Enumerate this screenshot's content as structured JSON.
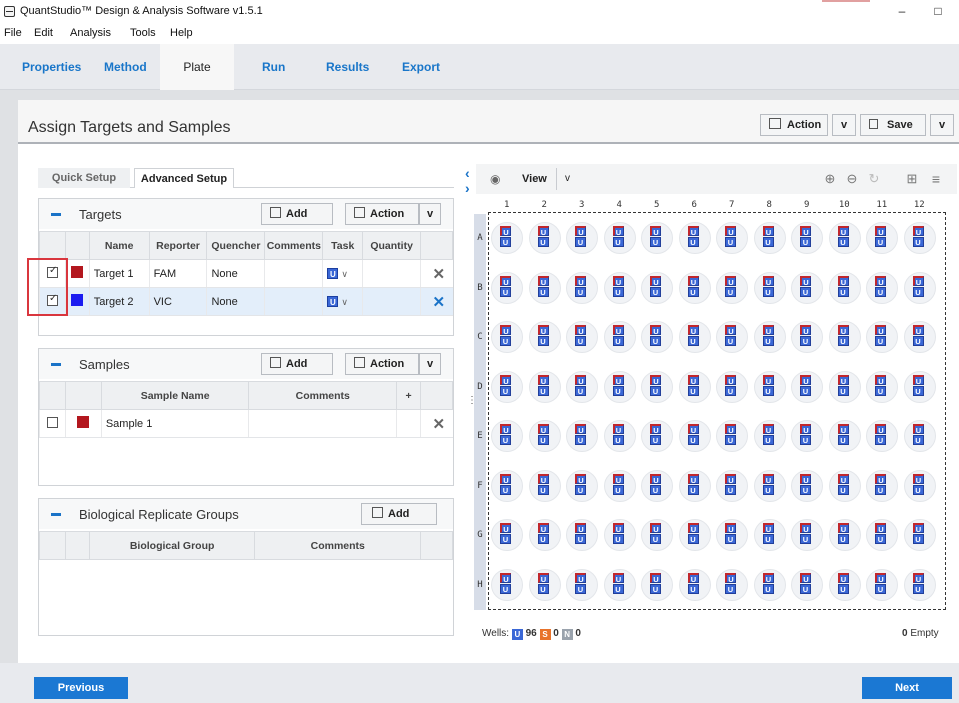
{
  "window": {
    "title": "QuantStudio™ Design & Analysis Software v1.5.1",
    "minimize": "–",
    "maximize": "□"
  },
  "menu": [
    "File",
    "Edit",
    "Analysis",
    "Tools",
    "Help"
  ],
  "tabs": [
    "Properties",
    "Method",
    "Plate",
    "Run",
    "Results",
    "Export"
  ],
  "active_tab": "Plate",
  "panel": {
    "title": "Assign Targets and Samples",
    "action_label": "Action",
    "save_label": "Save"
  },
  "setup_tabs": [
    "Quick Setup",
    "Advanced Setup"
  ],
  "targets": {
    "title": "Targets",
    "add_label": "Add",
    "action_label": "Action",
    "columns": [
      "Name",
      "Reporter",
      "Quencher",
      "Comments",
      "Task",
      "Quantity"
    ],
    "rows": [
      {
        "name": "Target 1",
        "reporter": "FAM",
        "quencher": "None",
        "task": "U",
        "color": "#b3171e",
        "checked": true
      },
      {
        "name": "Target 2",
        "reporter": "VIC",
        "quencher": "None",
        "task": "U",
        "color": "#1b1bf0",
        "checked": true
      }
    ]
  },
  "samples": {
    "title": "Samples",
    "add_label": "Add",
    "action_label": "Action",
    "columns": [
      "Sample Name",
      "Comments",
      "+"
    ],
    "rows": [
      {
        "name": "Sample 1",
        "color": "#b3171e"
      }
    ]
  },
  "bio_groups": {
    "title": "Biological Replicate Groups",
    "add_label": "Add",
    "columns": [
      "Biological Group",
      "Comments"
    ]
  },
  "plate": {
    "view_label": "View",
    "columns": [
      "1",
      "2",
      "3",
      "4",
      "5",
      "6",
      "7",
      "8",
      "9",
      "10",
      "11",
      "12"
    ],
    "rows": [
      "A",
      "B",
      "C",
      "D",
      "E",
      "F",
      "G",
      "H"
    ],
    "well_task": "U"
  },
  "wells_summary": {
    "label": "Wells:",
    "u": "U",
    "u_count": "96",
    "s": "S",
    "s_count": "0",
    "n": "N",
    "n_count": "0",
    "empty_count": "0",
    "empty_label": "Empty"
  },
  "footer": {
    "previous": "Previous",
    "next": "Next"
  },
  "icons": {
    "delete": "✕",
    "dropdown": "v",
    "collapse": "–"
  }
}
